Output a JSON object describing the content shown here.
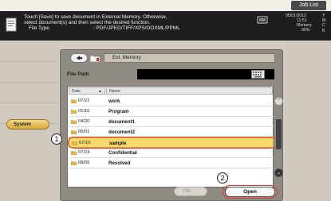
{
  "top_bar": {
    "job_list_label": "Job List"
  },
  "message": {
    "line1": "Touch [Save] to save document in External Memory. Otherwise,",
    "line2": "select document(s) and then select the desired function.",
    "file_type_label": "File Type",
    "file_type_value": ": PDF/JPEG/TIFF/XPS/OOXML/PPML"
  },
  "status": {
    "date": "05/01/2012",
    "time": "11:51",
    "memory_label": "Memory",
    "memory_value": "99%",
    "toner_letters": [
      "Y",
      "M",
      "C",
      "K"
    ]
  },
  "sidebar": {
    "system_label": "System"
  },
  "dialog": {
    "path_title": "Ext. Memory",
    "file_path_label": "File Path",
    "file_path_value": "",
    "columns": {
      "date": "Date",
      "name": "Name",
      "sort_arrow": "▲"
    },
    "rows": [
      {
        "date": "07/22",
        "name": "work",
        "selected": false
      },
      {
        "date": "01/10",
        "name": "Program",
        "selected": false
      },
      {
        "date": "04/20",
        "name": "document1",
        "selected": false
      },
      {
        "date": "06/01",
        "name": "document2",
        "selected": false
      },
      {
        "date": "07/10",
        "name": "sample",
        "selected": true
      },
      {
        "date": "07/24",
        "name": "Confidential",
        "selected": false
      },
      {
        "date": "08/06",
        "name": "Resolved",
        "selected": false
      }
    ],
    "file_button_label": "File",
    "open_button_label": "Open"
  },
  "callouts": {
    "one": "1",
    "two": "2"
  },
  "colors": {
    "selected_row": "#f6d96a",
    "highlight_ring": "#e23a2a",
    "message_bar": "#1e1e1e",
    "system_button": "#e7c060"
  },
  "icons": {
    "document": "document-icon",
    "back": "back-arrow-icon",
    "folder": "folder-icon",
    "keyboard": "keyboard-icon",
    "scroll_up": "scroll-up-icon",
    "scroll_down": "scroll-down-icon"
  }
}
